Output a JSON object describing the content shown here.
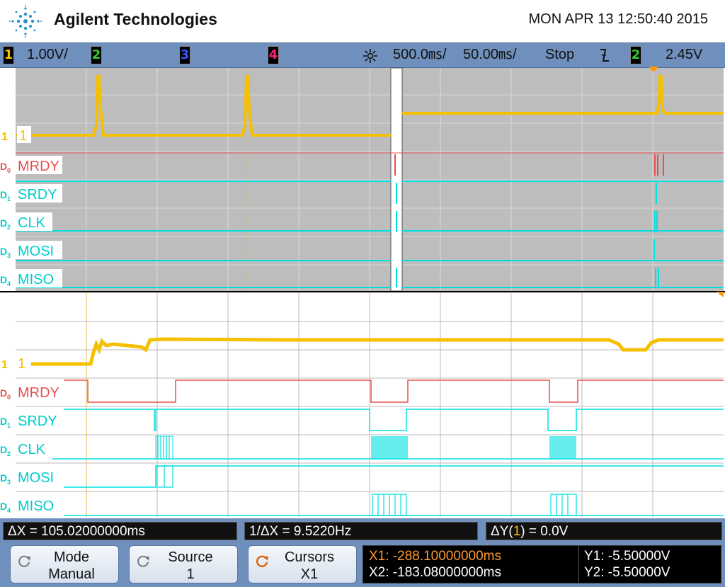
{
  "header": {
    "brand": "Agilent Technologies",
    "datetime": "MON APR 13 12:50:40 2015"
  },
  "status": {
    "ch1_num": "1",
    "ch1_scale": "1.00V/",
    "ch2_num": "2",
    "ch3_num": "3",
    "ch4_num": "4",
    "timebase_main": "500.0㎳/",
    "timebase_zoom": "50.00㎳/",
    "run_state": "Stop",
    "trigger_edge": "ʃ",
    "trigger_source": "2",
    "trigger_level": "2.45V"
  },
  "colors": {
    "ch1": "#f5c000",
    "d0": "#e84f4f",
    "digital": "#00e0e0",
    "ch2": "#33cc33",
    "ch3": "#3355ff",
    "ch4": "#ff2277",
    "grid_top_bg": "#bdbdbd",
    "grid_bottom_bg": "#ffffff",
    "bar": "#6f8fbd"
  },
  "channels": {
    "analog_marker": "1",
    "d0": "MRDY",
    "d1": "SRDY",
    "d2": "CLK",
    "d3": "MOSI",
    "d4": "MISO",
    "d0_tag": "D",
    "d0_sub": "0",
    "d1_sub": "1",
    "d2_sub": "2",
    "d3_sub": "3",
    "d4_sub": "4"
  },
  "measurements": {
    "delta_x": "ΔX = 105.02000000ms",
    "inv_delta_x": "1/ΔX = 9.5220Hz",
    "delta_y_prefix": "ΔY(",
    "delta_y_ch": "1",
    "delta_y_suffix": ") = 0.0V"
  },
  "softkeys": {
    "mode_label": "Mode",
    "mode_value": "Manual",
    "source_label": "Source",
    "source_value": "1",
    "cursors_label": "Cursors",
    "cursors_value": "X1"
  },
  "cursors": {
    "x1": "X1: -288.10000000ms",
    "x2": "X2: -183.08000000ms",
    "y1": "Y1: -5.50000V",
    "y2": "Y2: -5.50000V"
  }
}
